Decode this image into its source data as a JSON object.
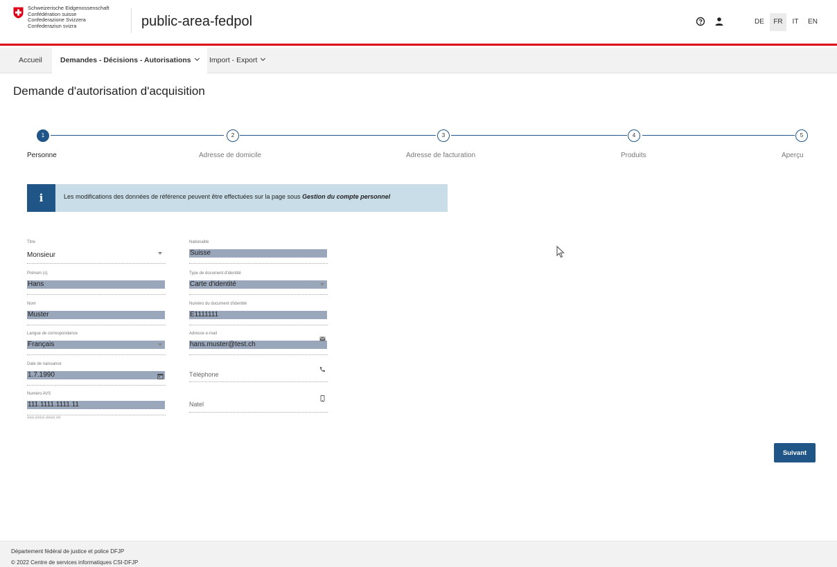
{
  "header": {
    "confederation_lines": [
      "Schweizerische Eidgenossenschaft",
      "Confédération suisse",
      "Confederazione Svizzera",
      "Confederaziun svizra"
    ],
    "app_title": "public-area-fedpol",
    "languages": [
      {
        "code": "DE",
        "active": false
      },
      {
        "code": "FR",
        "active": true
      },
      {
        "code": "IT",
        "active": false
      },
      {
        "code": "EN",
        "active": false
      }
    ],
    "icons": {
      "help": "help-icon",
      "user": "user-icon"
    }
  },
  "nav": {
    "items": [
      {
        "label": "Accueil"
      },
      {
        "label": "Demandes - Décisions - Autorisations"
      },
      {
        "label": "Import - Export"
      }
    ]
  },
  "page_title": "Demande d'autorisation d'acquisition",
  "stepper": {
    "current_step": 1,
    "steps": [
      {
        "number": "1",
        "label": "Personne"
      },
      {
        "number": "2",
        "label": "Adresse de domicile"
      },
      {
        "number": "3",
        "label": "Adresse de facturation"
      },
      {
        "number": "4",
        "label": "Produits"
      },
      {
        "number": "5",
        "label": "Aperçu"
      }
    ]
  },
  "info_box": {
    "text": "Les modifications des données de référence peuvent être effectuées sur la page sous ",
    "emphasis": "Gestion du compte personnel"
  },
  "form": {
    "titre": {
      "label": "Titre",
      "value": "Monsieur"
    },
    "prenom": {
      "label": "Prénom (s)",
      "value": "Hans"
    },
    "nom": {
      "label": "Nom",
      "value": "Muster"
    },
    "langue": {
      "label": "Langue de correspondance",
      "value": "Français"
    },
    "date_naissance": {
      "label": "Date de naissance",
      "value": "1.7.1990"
    },
    "avs": {
      "label": "Numéro AVS",
      "value": "111.1111.1111.11",
      "hint": "###.####.####.##"
    },
    "nationalite": {
      "label": "Nationalité",
      "value": "Suisse"
    },
    "type_document": {
      "label": "Type de document d'identité",
      "value": "Carte d'identité"
    },
    "numero_document": {
      "label": "Numéro du document d'identité",
      "value": "E1111111"
    },
    "email": {
      "label": "Adresse e-mail",
      "value": "hans.muster@test.ch"
    },
    "telephone": {
      "placeholder": "Téléphone"
    },
    "natel": {
      "placeholder": "Natel"
    }
  },
  "buttons": {
    "next": "Suivant"
  },
  "footer": {
    "line1": "Département fédéral de justice et police DFJP",
    "line2": "© 2022 Centre de services informatiques CSI-DFJP"
  },
  "colors": {
    "brand_red": "#dc0018",
    "primary_blue": "#1f5687",
    "info_bg": "#c9dde9",
    "field_fill": "#9aa7bb"
  }
}
